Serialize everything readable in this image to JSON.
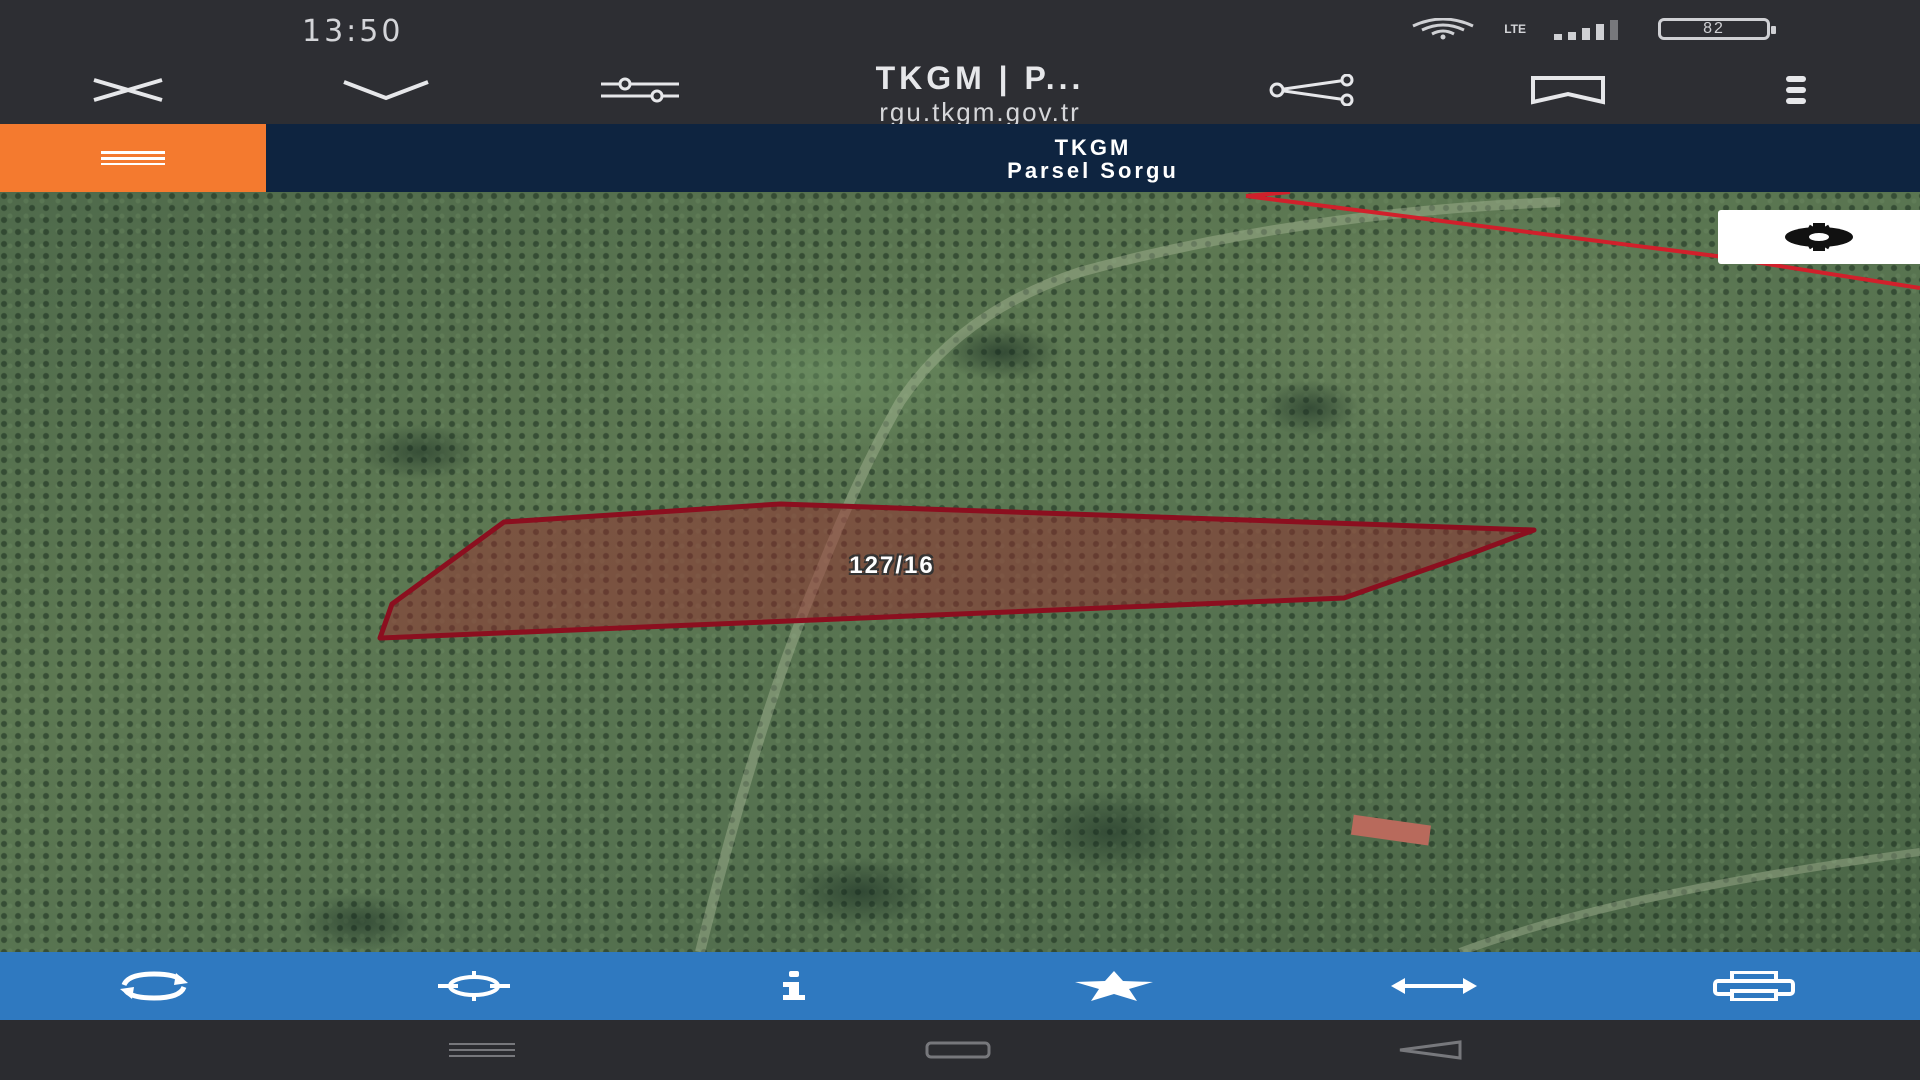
{
  "status_bar": {
    "time": "13:50",
    "network": "LTE",
    "battery_level": "82"
  },
  "browser": {
    "title": "TKGM | P...",
    "url": "rgu.tkgm.gov.tr"
  },
  "site_header": {
    "title_line1": "TKGM",
    "title_line2": "Parsel Sorgu",
    "menu_color": "#f47a2f",
    "header_color": "#0e2440"
  },
  "map": {
    "parcel_label": "127/16",
    "parcel_outline_color": "#8b0f1f",
    "boundary_color": "#d1202b"
  },
  "map_toolbar": {
    "color": "#2f79c0",
    "items": [
      {
        "name": "refresh",
        "icon": "refresh-icon"
      },
      {
        "name": "locate",
        "icon": "crosshair-icon"
      },
      {
        "name": "info",
        "icon": "info-icon"
      },
      {
        "name": "favorite",
        "icon": "star-icon"
      },
      {
        "name": "measure",
        "icon": "double-arrow-icon"
      },
      {
        "name": "print",
        "icon": "printer-icon"
      }
    ]
  }
}
